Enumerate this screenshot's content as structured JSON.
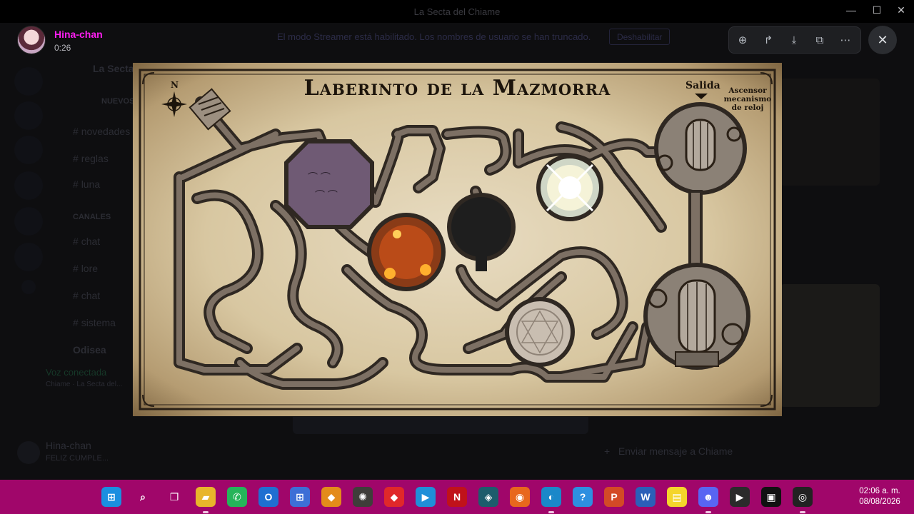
{
  "window": {
    "title": "La Secta del Chiame",
    "controls": [
      "minimize",
      "maximize",
      "close"
    ]
  },
  "streamer_banner": {
    "message": "El modo Streamer está habilitado. Los nombres de usuario se han truncado.",
    "button": "Deshabilitar"
  },
  "background": {
    "server_name": "La Secta",
    "channels": [
      "NUEVOS",
      "novedades",
      "reglas",
      "luna",
      "CANALES",
      "chat",
      "lore",
      "chat",
      "sistema",
      "Odisea"
    ],
    "voice_status": "Voz conectada",
    "voice_sub": "Chiame · La Secta del...",
    "user": {
      "name": "Hina-chan",
      "status": "FELIZ CUMPLE..."
    },
    "composer_placeholder": "Enviar mensaje a Chiame"
  },
  "viewer": {
    "poster_name": "Hina-chan",
    "poster_time": "0:26",
    "toolbar": [
      {
        "name": "zoom-icon",
        "glyph": "⊕"
      },
      {
        "name": "forward-icon",
        "glyph": "↱"
      },
      {
        "name": "download-icon",
        "glyph": "⤓"
      },
      {
        "name": "open-external-icon",
        "glyph": "⧉"
      },
      {
        "name": "more-icon",
        "glyph": "⋯"
      }
    ],
    "close_glyph": "✕"
  },
  "map": {
    "title": "Laberinto de la Mazmorra",
    "exit_label": "Salida",
    "elevator_label_1": "Ascensor",
    "elevator_label_2": "mecanismo",
    "elevator_label_3": "de reloj",
    "compass_label": "N",
    "colors": {
      "parchment": "#e0d2b3",
      "ink": "#1c140b",
      "wall": "#3a3128",
      "corridor": "#5a5048",
      "purple": "#6f5a74",
      "fire": "#c9521a",
      "dark": "#1e1e1e",
      "glow": "#f5f3d8",
      "circle": "#c9beb1"
    }
  },
  "taskbar": {
    "apps": [
      {
        "name": "start-icon",
        "glyph": "⊞",
        "color": "#1a8fe0"
      },
      {
        "name": "search-icon",
        "glyph": "⌕",
        "color": "transparent"
      },
      {
        "name": "task-view-icon",
        "glyph": "❐",
        "color": "transparent"
      },
      {
        "name": "file-explorer-icon",
        "glyph": "▰",
        "color": "#e8b52b",
        "active": true
      },
      {
        "name": "whatsapp-icon",
        "glyph": "✆",
        "color": "#25b45a"
      },
      {
        "name": "outlook-icon",
        "glyph": "O",
        "color": "#1f6fd1"
      },
      {
        "name": "store-icon",
        "glyph": "⊞",
        "color": "#3d6ed6"
      },
      {
        "name": "app-orange-icon",
        "glyph": "◆",
        "color": "#e38b1a"
      },
      {
        "name": "app-beetle-icon",
        "glyph": "✺",
        "color": "#3f3d3a"
      },
      {
        "name": "app-red-diamond-icon",
        "glyph": "◆",
        "color": "#e0282a"
      },
      {
        "name": "prime-video-icon",
        "glyph": "▶",
        "color": "#1f8fd8"
      },
      {
        "name": "netflix-icon",
        "glyph": "N",
        "color": "#c0121a"
      },
      {
        "name": "app-teal-icon",
        "glyph": "◈",
        "color": "#1d5c6c"
      },
      {
        "name": "firefox-icon",
        "glyph": "◉",
        "color": "#e8671d"
      },
      {
        "name": "edge-icon",
        "glyph": "◐",
        "color": "#1a88c9",
        "active": true
      },
      {
        "name": "help-icon",
        "glyph": "?",
        "color": "#2d8fe0"
      },
      {
        "name": "powerpoint-icon",
        "glyph": "P",
        "color": "#d34a26"
      },
      {
        "name": "word-icon",
        "glyph": "W",
        "color": "#2b5fb8"
      },
      {
        "name": "sticky-notes-icon",
        "glyph": "▤",
        "color": "#f4d52b"
      },
      {
        "name": "discord-icon",
        "glyph": "☻",
        "color": "#5865f2",
        "active": true
      },
      {
        "name": "media-player-icon",
        "glyph": "▶",
        "color": "#2b2b2b"
      },
      {
        "name": "app-robot-icon",
        "glyph": "▣",
        "color": "#111111"
      },
      {
        "name": "obs-icon",
        "glyph": "◎",
        "color": "#222222",
        "active": true
      }
    ],
    "time": "02:06 a. m.",
    "date": "08/08/2026"
  }
}
